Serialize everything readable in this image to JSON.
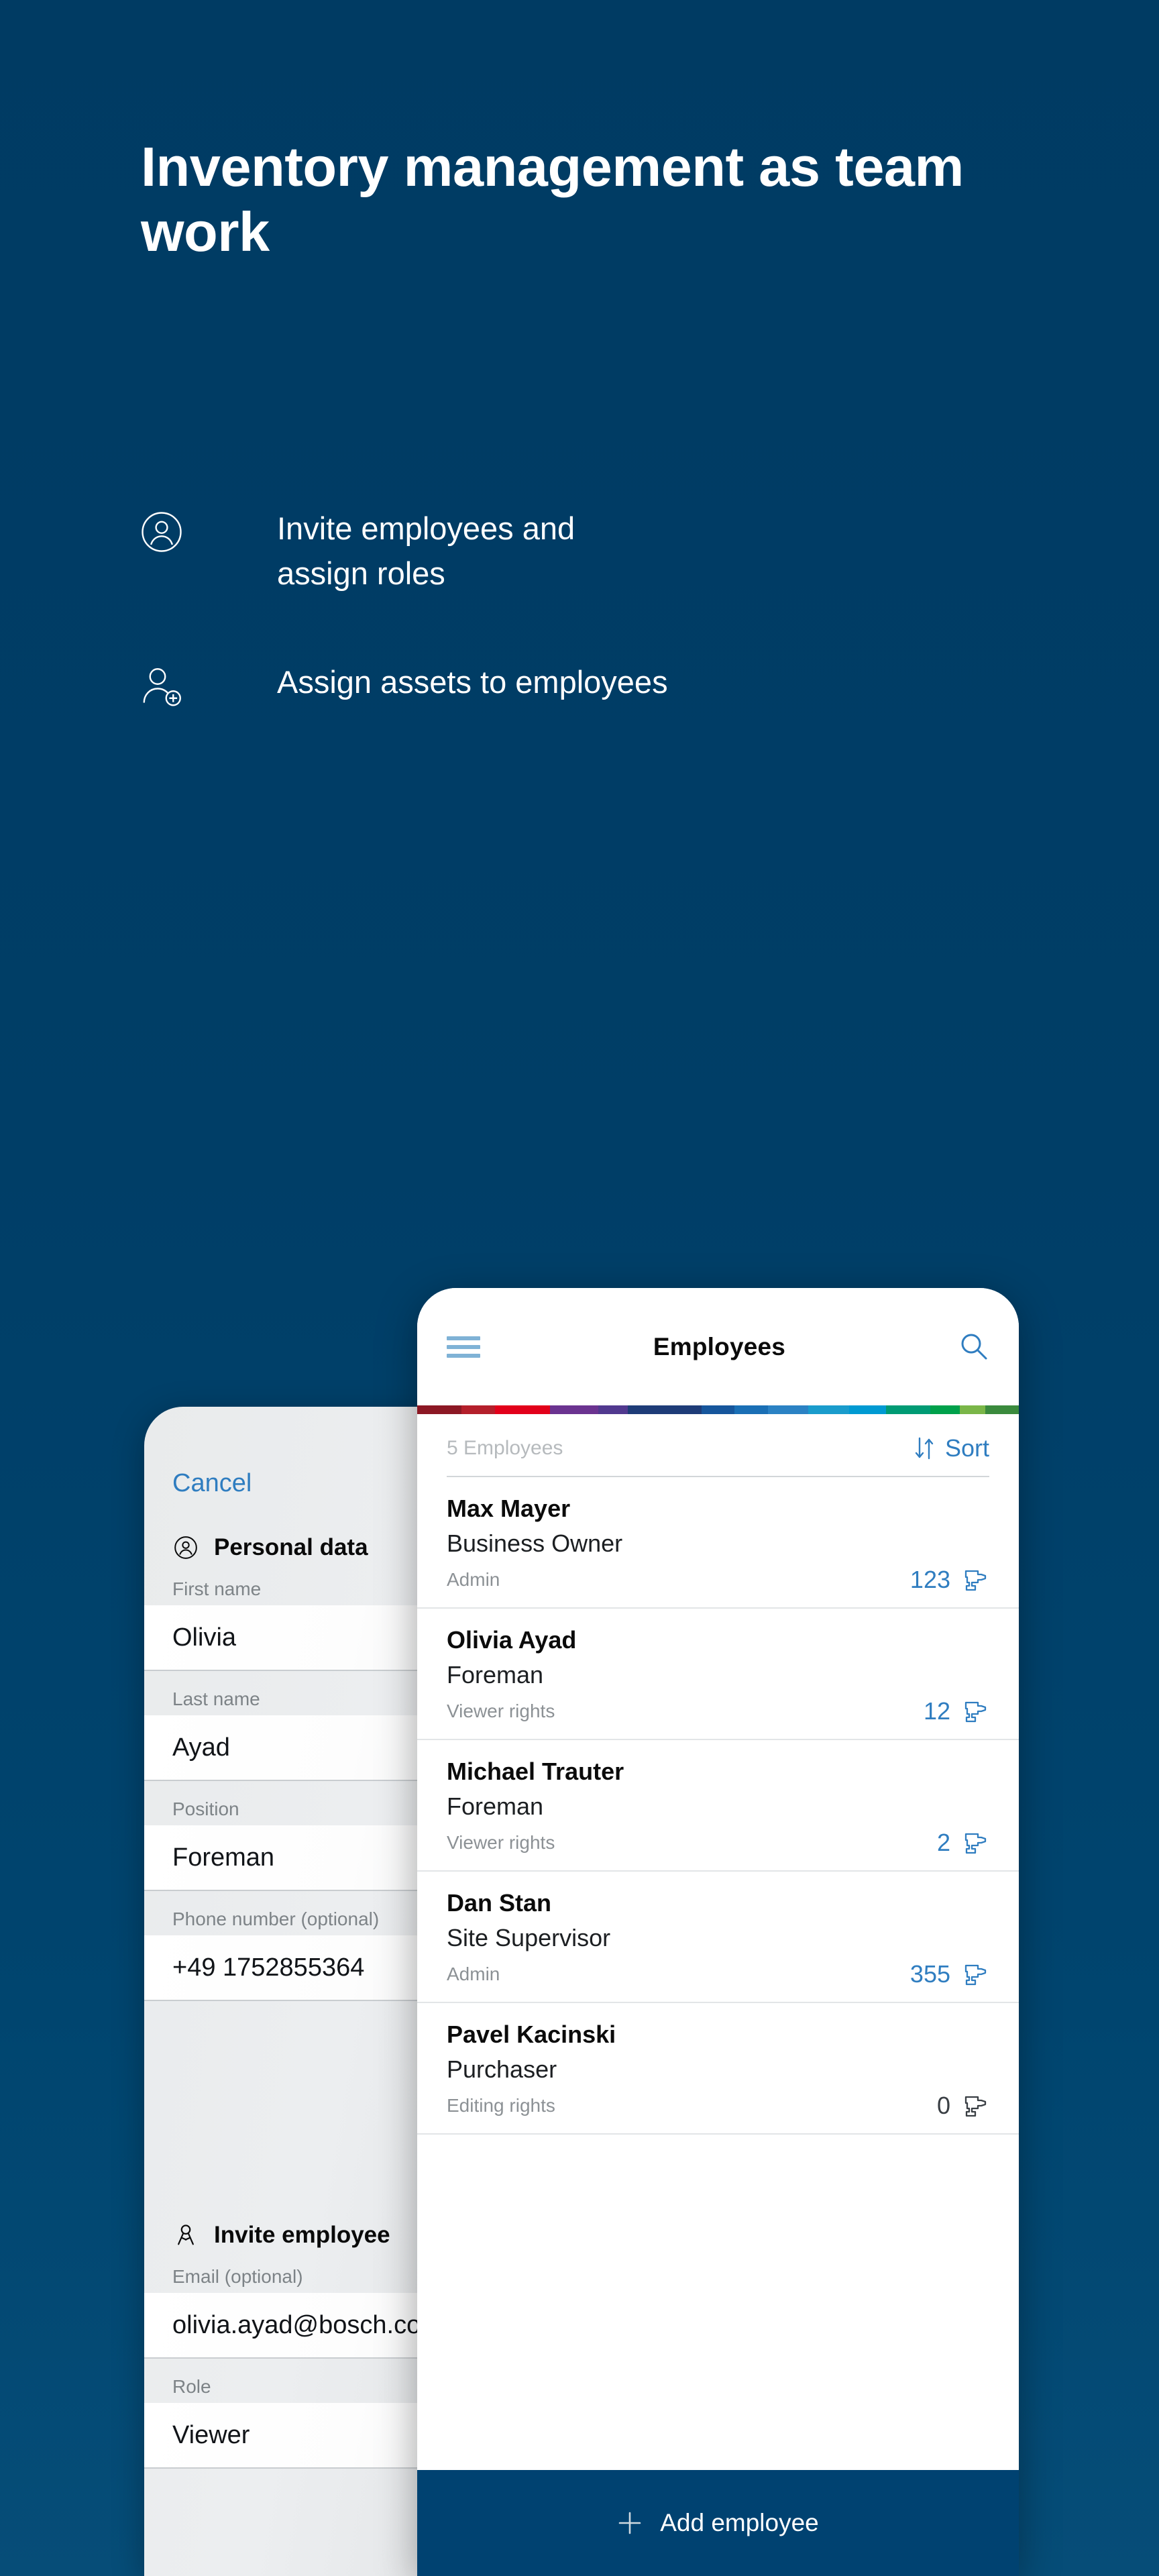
{
  "hero": {
    "title": "Inventory management as team work",
    "features": [
      {
        "icon": "user-circle-icon",
        "text": "Invite employees and\nassign roles"
      },
      {
        "icon": "user-add-icon",
        "text": "Assign assets to employees"
      }
    ]
  },
  "colors": {
    "background_top": "#003b63",
    "background_bottom": "#064d78",
    "accent_blue": "#2f7dc0",
    "footer_blue": "#004271",
    "muted_gray": "#8c9195"
  },
  "supergraphic": [
    "#8c1824",
    "#b41f2b",
    "#e2001a",
    "#7a2f8f",
    "#5a3a96",
    "#1e3c78",
    "#0a4a8f",
    "#1a6fb5",
    "#2b82c4",
    "#009ad2",
    "#00a0d8",
    "#009b74",
    "#00a14b",
    "#7ab648",
    "#3a8a3d"
  ],
  "form_phone": {
    "cancel_label": "Cancel",
    "sections": [
      {
        "icon": "user-circle-icon",
        "title": "Personal data",
        "fields": [
          {
            "label": "First name",
            "value": "Olivia"
          },
          {
            "label": "Last name",
            "value": "Ayad"
          },
          {
            "label": "Position",
            "value": "Foreman"
          },
          {
            "label": "Phone number (optional)",
            "value": "+49 1752855364"
          }
        ]
      },
      {
        "icon": "keys-icon",
        "title": "Invite employee",
        "fields": [
          {
            "label": "Email (optional)",
            "value": "olivia.ayad@bosch.com"
          },
          {
            "label": "Role",
            "value": "Viewer"
          }
        ]
      }
    ]
  },
  "list_phone": {
    "appbar": {
      "menu_icon": "hamburger-menu-icon",
      "title": "Employees",
      "search_icon": "search-icon"
    },
    "count_label": "5 Employees",
    "sort": {
      "icon": "sort-arrows-icon",
      "label": "Sort"
    },
    "employees": [
      {
        "name": "Max Mayer",
        "position": "Business Owner",
        "rights": "Admin",
        "count": "123",
        "count_muted": false,
        "tool_icon": "drill-icon"
      },
      {
        "name": "Olivia Ayad",
        "position": "Foreman",
        "rights": "Viewer rights",
        "count": "12",
        "count_muted": false,
        "tool_icon": "drill-icon"
      },
      {
        "name": "Michael Trauter",
        "position": "Foreman",
        "rights": "Viewer rights",
        "count": "2",
        "count_muted": false,
        "tool_icon": "drill-icon"
      },
      {
        "name": "Dan Stan",
        "position": "Site Supervisor",
        "rights": "Admin",
        "count": "355",
        "count_muted": false,
        "tool_icon": "drill-icon"
      },
      {
        "name": "Pavel Kacinski",
        "position": "Purchaser",
        "rights": "Editing rights",
        "count": "0",
        "count_muted": true,
        "tool_icon": "drill-icon"
      }
    ],
    "footer": {
      "icon": "plus-icon",
      "label": "Add employee"
    }
  }
}
